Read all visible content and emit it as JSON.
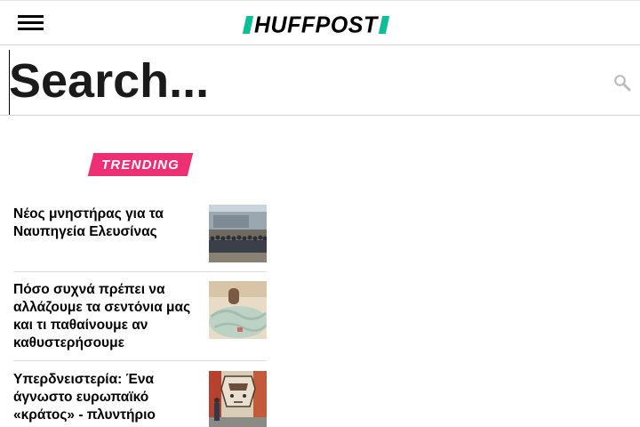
{
  "header": {
    "logo_text": "HUFFPOST",
    "menu_icon": "hamburger-menu-icon",
    "accent_color": "#0dbe98"
  },
  "search": {
    "placeholder": "Search...",
    "value": "",
    "icon": "search-icon"
  },
  "trending": {
    "label": "TRENDING",
    "badge_color": "#ee2f73",
    "items": [
      {
        "title": "Νέος μνηστήρας για τα Ναυπηγεία Ελευσίνας",
        "image": "group-photo-thumbnail"
      },
      {
        "title": "Πόσο συχνά πρέπει να αλλάζουμε τα σεντόνια μας και τι παθαίνουμε αν καθυστερήσουμε",
        "image": "bed-sheets-thumbnail"
      },
      {
        "title": "Υπερδνειστερία: Ένα άγνωστο ευρωπαϊκό «κράτος» - πλυντήριο",
        "image": "soviet-mural-thumbnail"
      }
    ]
  }
}
